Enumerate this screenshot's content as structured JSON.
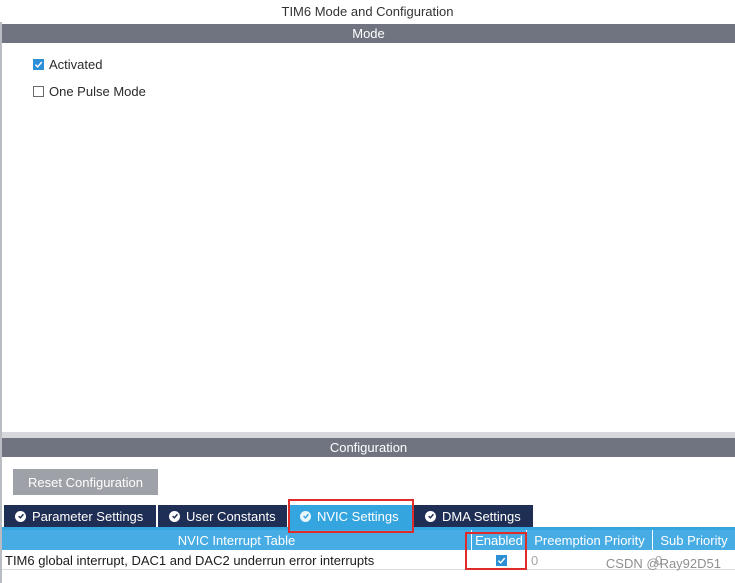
{
  "window": {
    "title": "TIM6 Mode and Configuration"
  },
  "mode": {
    "header": "Mode",
    "options": [
      {
        "label": "Activated",
        "checked": true
      },
      {
        "label": "One Pulse Mode",
        "checked": false
      }
    ]
  },
  "configuration": {
    "header": "Configuration",
    "reset_label": "Reset Configuration",
    "tabs": [
      {
        "label": "Parameter Settings",
        "active": false
      },
      {
        "label": "User Constants",
        "active": false
      },
      {
        "label": "NVIC Settings",
        "active": true
      },
      {
        "label": "DMA Settings",
        "active": false
      }
    ],
    "nvic_table": {
      "columns": [
        "NVIC Interrupt Table",
        "Enabled",
        "Preemption Priority",
        "Sub Priority"
      ],
      "rows": [
        {
          "name": "TIM6 global interrupt, DAC1 and DAC2 underrun error interrupts",
          "enabled": true,
          "preemption": "0",
          "sub": "0"
        }
      ]
    }
  },
  "watermark": "CSDN @Ray92D51",
  "colors": {
    "section_header": "#6f7480",
    "tab_inactive": "#1f2e54",
    "tab_active": "#35a5e0",
    "table_header": "#48ace4",
    "checkbox_checked": "#2d8fd5",
    "highlight_box": "#e02b2b"
  }
}
